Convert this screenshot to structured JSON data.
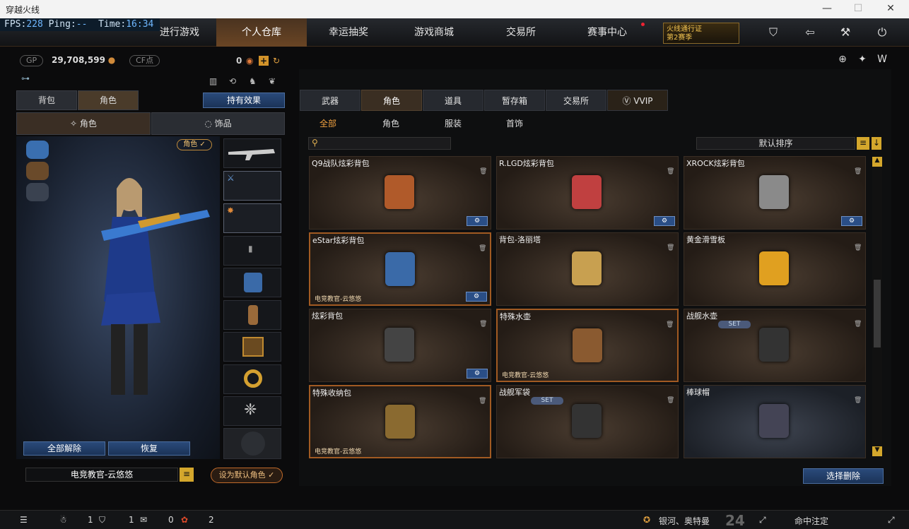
{
  "window": {
    "title": "穿越火线"
  },
  "fps": {
    "fps_label": "FPS:",
    "fps": "228",
    "ping_label": "Ping:",
    "ping": "--",
    "time_label": "Time:",
    "time": "16:34"
  },
  "nav": {
    "tabs": [
      "进行游戏",
      "个人仓库",
      "幸运抽奖",
      "游戏商城",
      "交易所",
      "赛事中心"
    ],
    "active": 1,
    "pass_line1": "火线通行证",
    "pass_line2": "第2赛季"
  },
  "currency": {
    "gp_label": "GP",
    "gp_value": "29,708,599",
    "cf_label": "CF点",
    "cf_value": "0"
  },
  "left": {
    "tab_backpack": "背包",
    "tab_character": "角色",
    "effect_button": "持有效果",
    "sub_character": "角色",
    "sub_accessory": "饰品",
    "role_badge": "角色 ✓",
    "unequip_all": "全部解除",
    "restore": "恢复",
    "character_name": "电竞教官-云悠悠",
    "set_default": "设为默认角色 ✓"
  },
  "right": {
    "tabs": [
      "武器",
      "角色",
      "道具",
      "暂存箱",
      "交易所",
      "VVIP"
    ],
    "active_tab": 1,
    "subtabs": [
      "全部",
      "角色",
      "服装",
      "首饰"
    ],
    "active_subtab": 0,
    "sort_label": "默认排序",
    "search_placeholder": "",
    "select_delete": "选择删除",
    "items": [
      {
        "name": "Q9战队炫彩背包",
        "owner": "",
        "set": false,
        "gear": true
      },
      {
        "name": "R.LGD炫彩背包",
        "owner": "",
        "set": false,
        "gear": true
      },
      {
        "name": "XROCK炫彩背包",
        "owner": "",
        "set": false,
        "gear": true
      },
      {
        "name": "eStar炫彩背包",
        "owner": "电竞教官-云悠悠",
        "set": false,
        "gear": true
      },
      {
        "name": "背包-洛丽塔",
        "owner": "",
        "set": false,
        "gear": false
      },
      {
        "name": "黄金滑雪板",
        "owner": "",
        "set": false,
        "gear": false
      },
      {
        "name": "炫彩背包",
        "owner": "",
        "set": false,
        "gear": true
      },
      {
        "name": "特殊水壶",
        "owner": "电竞教官-云悠悠",
        "set": false,
        "gear": false
      },
      {
        "name": "战舰水壶",
        "owner": "",
        "set": true,
        "gear": false
      },
      {
        "name": "特殊收纳包",
        "owner": "电竞教官-云悠悠",
        "set": false,
        "gear": false
      },
      {
        "name": "战舰军袋",
        "owner": "",
        "set": true,
        "gear": false
      },
      {
        "name": "棒球帽",
        "owner": "",
        "set": false,
        "gear": false
      }
    ],
    "set_label": "SET"
  },
  "bottom": {
    "friends": "1",
    "clan": "1",
    "chat": "0",
    "gift": "2",
    "marquee": "银河、奥特曼",
    "rank_num": "24",
    "status": "命中注定"
  }
}
